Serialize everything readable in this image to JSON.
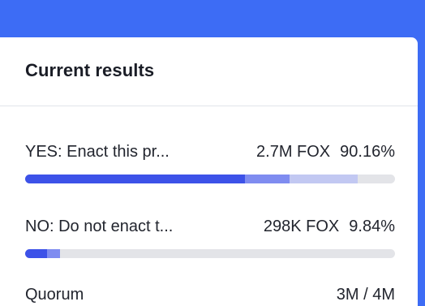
{
  "panel": {
    "title": "Current results"
  },
  "options": [
    {
      "label": "YES: Enact this pr...",
      "amount": "2.7M FOX",
      "percent": "90.16%",
      "bar": {
        "filled_fractions": [
          0.595,
          0.12,
          0.185
        ]
      }
    },
    {
      "label": "NO: Do not enact t...",
      "amount": "298K FOX",
      "percent": "9.84%",
      "bar": {
        "filled_fractions": [
          0.06,
          0.035,
          0.0
        ]
      }
    }
  ],
  "quorum": {
    "label": "Quorum",
    "value": "3M / 4M"
  },
  "colors": {
    "background_accent": "#3d6cf5",
    "bar_primary": "#3d52e8",
    "bar_secondary": "#7f8cf0",
    "bar_tertiary": "#c2c8f2",
    "bar_track": "#e3e4e8"
  }
}
